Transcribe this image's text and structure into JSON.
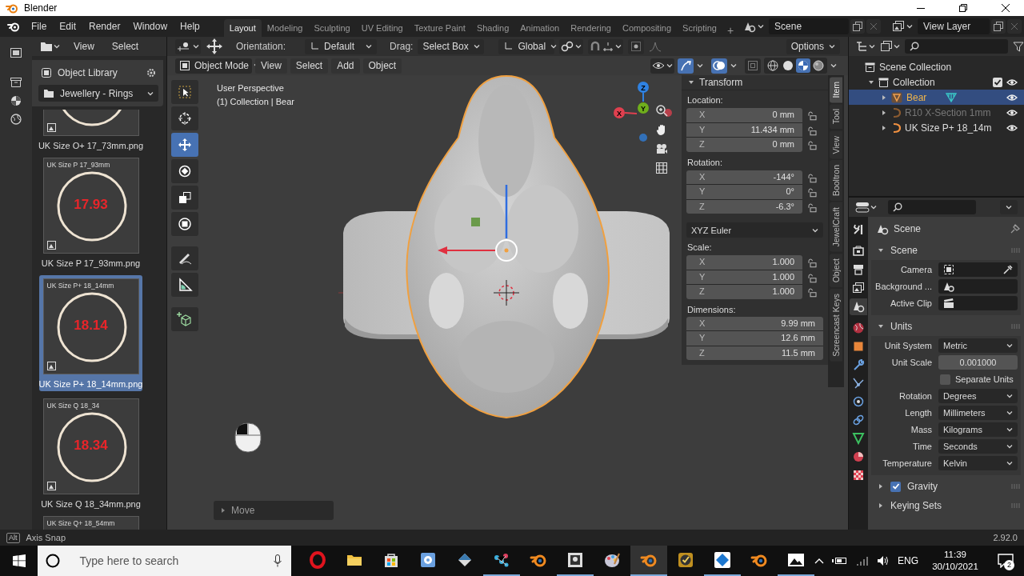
{
  "window": {
    "title": "Blender"
  },
  "menu": [
    "File",
    "Edit",
    "Render",
    "Window",
    "Help"
  ],
  "workspaces": [
    {
      "label": "Layout",
      "selected": true
    },
    {
      "label": "Modeling",
      "selected": false
    },
    {
      "label": "Sculpting",
      "selected": false
    },
    {
      "label": "UV Editing",
      "selected": false
    },
    {
      "label": "Texture Paint",
      "selected": false
    },
    {
      "label": "Shading",
      "selected": false
    },
    {
      "label": "Animation",
      "selected": false
    },
    {
      "label": "Rendering",
      "selected": false
    },
    {
      "label": "Compositing",
      "selected": false
    },
    {
      "label": "Scripting",
      "selected": false
    }
  ],
  "add_workspace": "+",
  "scene": "Scene",
  "view_layer": "View Layer",
  "asset_browser": {
    "menus": [
      "View",
      "Select"
    ],
    "library": "Object Library",
    "category": "Jewellery - Rings",
    "assets": [
      {
        "kind": "partial",
        "label": "UK Size O+ 17_73mm.png",
        "selected": false
      },
      {
        "kind": "full",
        "caption": "UK Size P 17_93mm",
        "number": "17.93",
        "label": "UK Size P 17_93mm.png",
        "selected": false
      },
      {
        "kind": "full",
        "caption": "UK Size P+ 18_14mm",
        "number": "18.14",
        "label": "UK Size P+ 18_14mm.png",
        "selected": true
      },
      {
        "kind": "full",
        "caption": "UK Size Q 18_34",
        "number": "18.34",
        "label": "UK Size Q 18_34mm.png",
        "selected": false
      },
      {
        "kind": "cut",
        "caption": "UK Size Q+ 18_54mm",
        "selected": false
      }
    ]
  },
  "viewport": {
    "orientation_label": "Orientation:",
    "orientation": "Default",
    "drag_label": "Drag:",
    "drag": "Select Box",
    "transform": "Global",
    "options": "Options",
    "mode": "Object Mode",
    "menus": [
      "View",
      "Select",
      "Add",
      "Object"
    ],
    "shading": [
      {
        "kind": "wireframe",
        "selected": false
      },
      {
        "kind": "solid",
        "selected": false
      },
      {
        "kind": "material",
        "selected": true
      },
      {
        "kind": "rendered",
        "selected": false
      }
    ],
    "tools": [
      {
        "kind": "select",
        "selected": false
      },
      {
        "kind": "cursor",
        "selected": false
      },
      {
        "kind": "move",
        "selected": true
      },
      {
        "kind": "rotate",
        "selected": false
      },
      {
        "kind": "scale",
        "selected": false
      },
      {
        "kind": "transform",
        "selected": false
      },
      {
        "kind": "annotate",
        "selected": false
      },
      {
        "kind": "measure",
        "selected": false
      },
      {
        "kind": "add",
        "selected": false
      }
    ],
    "perspective": "User Perspective",
    "context": "(1) Collection | Bear",
    "gizmo_axes": [
      {
        "label": "X",
        "color": "#e0404f"
      },
      {
        "label": "Y",
        "color": "#6fae1c"
      },
      {
        "label": "Z",
        "color": "#2f82e2"
      }
    ],
    "last_operator": "Move"
  },
  "sidebar": {
    "tabs": [
      {
        "label": "Item",
        "selected": true
      },
      {
        "label": "Tool",
        "selected": false
      },
      {
        "label": "View",
        "selected": false
      },
      {
        "label": "Booltron",
        "selected": false
      },
      {
        "label": "JewelCraft",
        "selected": false
      },
      {
        "label": "Object",
        "selected": false
      },
      {
        "label": "Screencast Keys",
        "selected": false
      }
    ],
    "title": "Transform",
    "expanded": true,
    "groups": [
      {
        "kind": "vector",
        "label": "Location:",
        "fields": [
          {
            "axis": "X",
            "value": "0 mm",
            "locked": false
          },
          {
            "axis": "Y",
            "value": "11.434 mm",
            "locked": false
          },
          {
            "axis": "Z",
            "value": "0 mm",
            "locked": false
          }
        ]
      },
      {
        "kind": "vector",
        "label": "Rotation:",
        "fields": [
          {
            "axis": "X",
            "value": "-144°",
            "locked": false
          },
          {
            "axis": "Y",
            "value": "0°",
            "locked": false
          },
          {
            "axis": "Z",
            "value": "-6.3°",
            "locked": false
          }
        ]
      },
      {
        "kind": "dropdown",
        "value": "XYZ Euler"
      },
      {
        "kind": "vector",
        "label": "Scale:",
        "fields": [
          {
            "axis": "X",
            "value": "1.000",
            "locked": false
          },
          {
            "axis": "Y",
            "value": "1.000",
            "locked": false
          },
          {
            "axis": "Z",
            "value": "1.000",
            "locked": false
          }
        ]
      },
      {
        "kind": "dimensions",
        "label": "Dimensions:",
        "fields": [
          {
            "axis": "X",
            "value": "9.99 mm"
          },
          {
            "axis": "Y",
            "value": "12.6 mm"
          },
          {
            "axis": "Z",
            "value": "11.5 mm"
          }
        ]
      }
    ]
  },
  "outliner": {
    "root": "Scene Collection",
    "collections": [
      {
        "label": "Collection",
        "expanded": true,
        "checked": true,
        "visible": true,
        "children": [
          {
            "label": "Bear",
            "kind": "mesh",
            "expanded": false,
            "selected": true,
            "disabled": false,
            "visible": true
          },
          {
            "label": "R10 X-Section 1mm",
            "kind": "curve",
            "expanded": false,
            "selected": false,
            "disabled": true,
            "visible": true
          },
          {
            "label": "UK Size P+ 18_14m",
            "kind": "curve",
            "expanded": false,
            "selected": false,
            "disabled": false,
            "visible": true
          }
        ]
      }
    ]
  },
  "properties": {
    "tabs": [
      {
        "kind": "tool",
        "selected": false
      },
      {
        "kind": "render",
        "selected": false
      },
      {
        "kind": "output",
        "selected": false
      },
      {
        "kind": "viewlayer",
        "selected": false
      },
      {
        "kind": "scene",
        "selected": true
      },
      {
        "kind": "world",
        "selected": false
      },
      {
        "kind": "object",
        "selected": false
      },
      {
        "kind": "modifier",
        "selected": false
      },
      {
        "kind": "particles",
        "selected": false
      },
      {
        "kind": "physics",
        "selected": false
      },
      {
        "kind": "constraint",
        "selected": false
      },
      {
        "kind": "data",
        "selected": false
      },
      {
        "kind": "material",
        "selected": false
      },
      {
        "kind": "texture",
        "selected": false
      }
    ],
    "context": "Scene",
    "panels": [
      {
        "title": "Scene",
        "expanded": true,
        "rows": [
          {
            "kind": "object",
            "label": "Camera"
          },
          {
            "kind": "object",
            "label": "Background ..."
          },
          {
            "kind": "object",
            "label": "Active Clip"
          }
        ]
      },
      {
        "title": "Units",
        "expanded": true,
        "rows": [
          {
            "kind": "dropdown",
            "label": "Unit System",
            "value": "Metric"
          },
          {
            "kind": "number",
            "label": "Unit Scale",
            "value": "0.001000"
          },
          {
            "kind": "checkbox",
            "label": "Separate Units",
            "checked": false
          },
          {
            "kind": "dropdown",
            "label": "Rotation",
            "value": "Degrees"
          },
          {
            "kind": "dropdown",
            "label": "Length",
            "value": "Millimeters"
          },
          {
            "kind": "dropdown",
            "label": "Mass",
            "value": "Kilograms"
          },
          {
            "kind": "dropdown",
            "label": "Time",
            "value": "Seconds"
          },
          {
            "kind": "dropdown",
            "label": "Temperature",
            "value": "Kelvin"
          }
        ]
      },
      {
        "title": "Gravity",
        "expanded": false,
        "checked": true
      },
      {
        "title": "Keying Sets",
        "expanded": false
      }
    ]
  },
  "status_bar": {
    "key": "Alt",
    "hint": "Axis Snap",
    "version": "2.92.0"
  },
  "taskbar": {
    "search_placeholder": "Type here to search",
    "apps": [
      {
        "kind": "ring",
        "running": false,
        "selected": false
      },
      {
        "kind": "folder",
        "running": false,
        "selected": false
      },
      {
        "kind": "store",
        "running": false,
        "selected": false
      },
      {
        "kind": "gear",
        "running": false,
        "selected": false
      },
      {
        "kind": "diamond",
        "running": false,
        "selected": false
      },
      {
        "kind": "dots",
        "running": true,
        "selected": false
      },
      {
        "kind": "blender",
        "running": false,
        "selected": false
      },
      {
        "kind": "scanner",
        "running": true,
        "selected": false
      },
      {
        "kind": "palette",
        "running": false,
        "selected": false
      },
      {
        "kind": "blender",
        "running": true,
        "selected": true
      },
      {
        "kind": "check",
        "running": false,
        "selected": false
      },
      {
        "kind": "tile",
        "running": true,
        "selected": false
      },
      {
        "kind": "blender",
        "running": false,
        "selected": false
      },
      {
        "kind": "photo",
        "running": true,
        "selected": false
      }
    ],
    "language": "ENG",
    "time": "11:39",
    "date": "30/10/2021",
    "notifications": "2"
  }
}
